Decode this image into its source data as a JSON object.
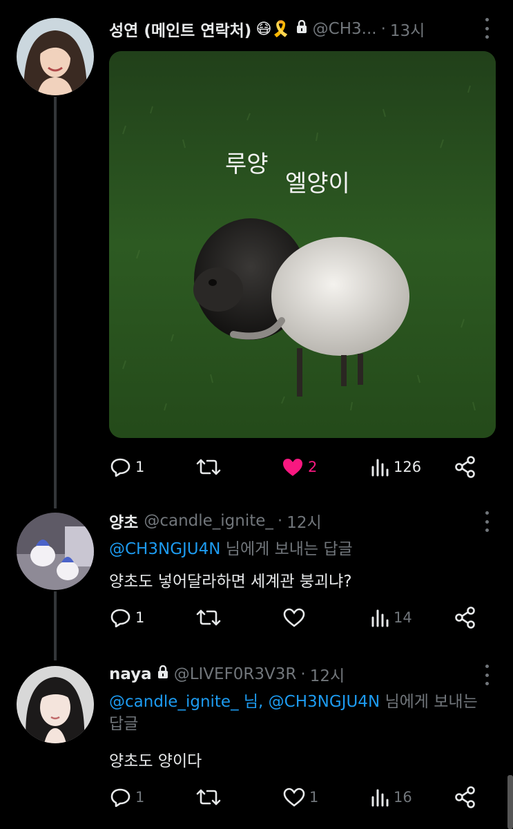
{
  "tweets": [
    {
      "name": "성연 (메인트 연락처)",
      "emoji": "😷🎗️",
      "handle": "@CH3...",
      "time": "13시",
      "image_caption_1": "루양",
      "image_caption_2": "엘양이",
      "stats": {
        "replies": "1",
        "retweets": "",
        "likes": "2",
        "views": "126"
      },
      "liked": true
    },
    {
      "name": "양초",
      "handle": "@candle_ignite_",
      "time": "12시",
      "reply_mention": "@CH3NGJU4N",
      "reply_suffix": " 님에게 보내는 답글",
      "text": "양초도 넣어달라하면 세계관 붕괴냐?",
      "stats": {
        "replies": "1",
        "retweets": "",
        "likes": "",
        "views": "14"
      }
    },
    {
      "name": "naya",
      "handle": "@LIVEF0R3V3R",
      "time": "12시",
      "reply_mention": "@candle_ignite_ 님, @CH3NGJU4N",
      "reply_suffix": " 님에게 보내는 답글",
      "text": "양초도 양이다",
      "stats": {
        "replies": "1",
        "retweets": "",
        "likes": "1",
        "views": "16"
      }
    }
  ],
  "colors": {
    "accent": "#1d9bf0",
    "like": "#f91880",
    "muted": "#71767b"
  }
}
